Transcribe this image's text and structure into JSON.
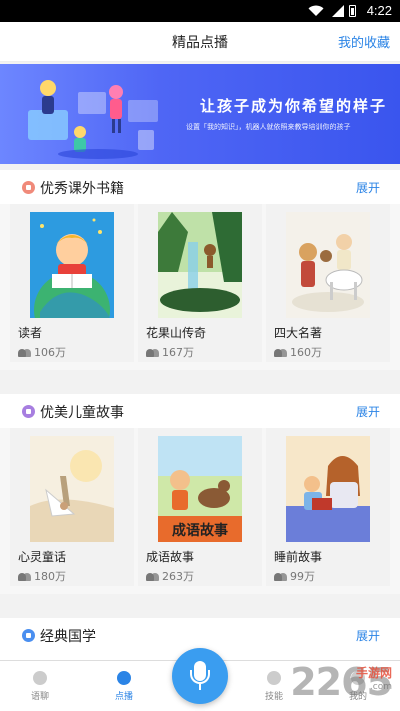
{
  "status": {
    "time": "4:22"
  },
  "header": {
    "title": "精品点播",
    "favorites": "我的收藏"
  },
  "banner": {
    "slogan": "让孩子成为你希望的样子",
    "subline": "设置「我的知识」，机器人就依照来教导培训你的孩子"
  },
  "sections": [
    {
      "title": "优秀课外书籍",
      "expand": "展开",
      "icon_color": "#f08a7a",
      "books": [
        {
          "name": "读者",
          "plays": "106万"
        },
        {
          "name": "花果山传奇",
          "plays": "167万"
        },
        {
          "name": "四大名著",
          "plays": "160万"
        }
      ]
    },
    {
      "title": "优美儿童故事",
      "expand": "展开",
      "icon_color": "#a77ee0",
      "books": [
        {
          "name": "心灵童话",
          "plays": "180万"
        },
        {
          "name": "成语故事",
          "plays": "263万",
          "cover_text": "成语故事"
        },
        {
          "name": "睡前故事",
          "plays": "99万"
        }
      ]
    },
    {
      "title": "经典国学",
      "expand": "展开",
      "icon_color": "#4a8ff0"
    }
  ],
  "tabs": [
    {
      "label": "语聊",
      "active": false,
      "icon": "chat-icon"
    },
    {
      "label": "点播",
      "active": true,
      "icon": "planet-icon"
    },
    {
      "label": "技能",
      "active": false,
      "icon": "skill-icon"
    },
    {
      "label": "我的",
      "active": false,
      "icon": "profile-icon"
    }
  ],
  "watermark": {
    "number": "2265",
    "site": "手游网",
    "url": ".com"
  },
  "colors": {
    "accent": "#2b84e6",
    "banner": "#4f66f5",
    "mic": "#3a9df0"
  }
}
